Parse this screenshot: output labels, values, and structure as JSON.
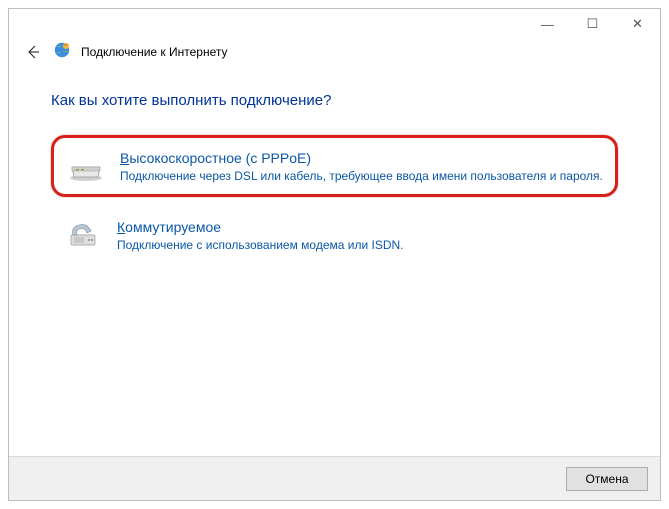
{
  "titlebar": {
    "minimize": "—",
    "maximize": "☐",
    "close": "✕"
  },
  "header": {
    "title": "Подключение к Интернету"
  },
  "content": {
    "question": "Как вы хотите выполнить подключение?",
    "options": [
      {
        "firstLetter": "В",
        "restTitle": "ысокоскоростное (с PPPoE)",
        "desc": "Подключение через DSL или кабель, требующее ввода имени пользователя и пароля."
      },
      {
        "firstLetter": "К",
        "restTitle": "оммутируемое",
        "desc": "Подключение с использованием модема или ISDN."
      }
    ]
  },
  "footer": {
    "cancel": "Отмена"
  }
}
